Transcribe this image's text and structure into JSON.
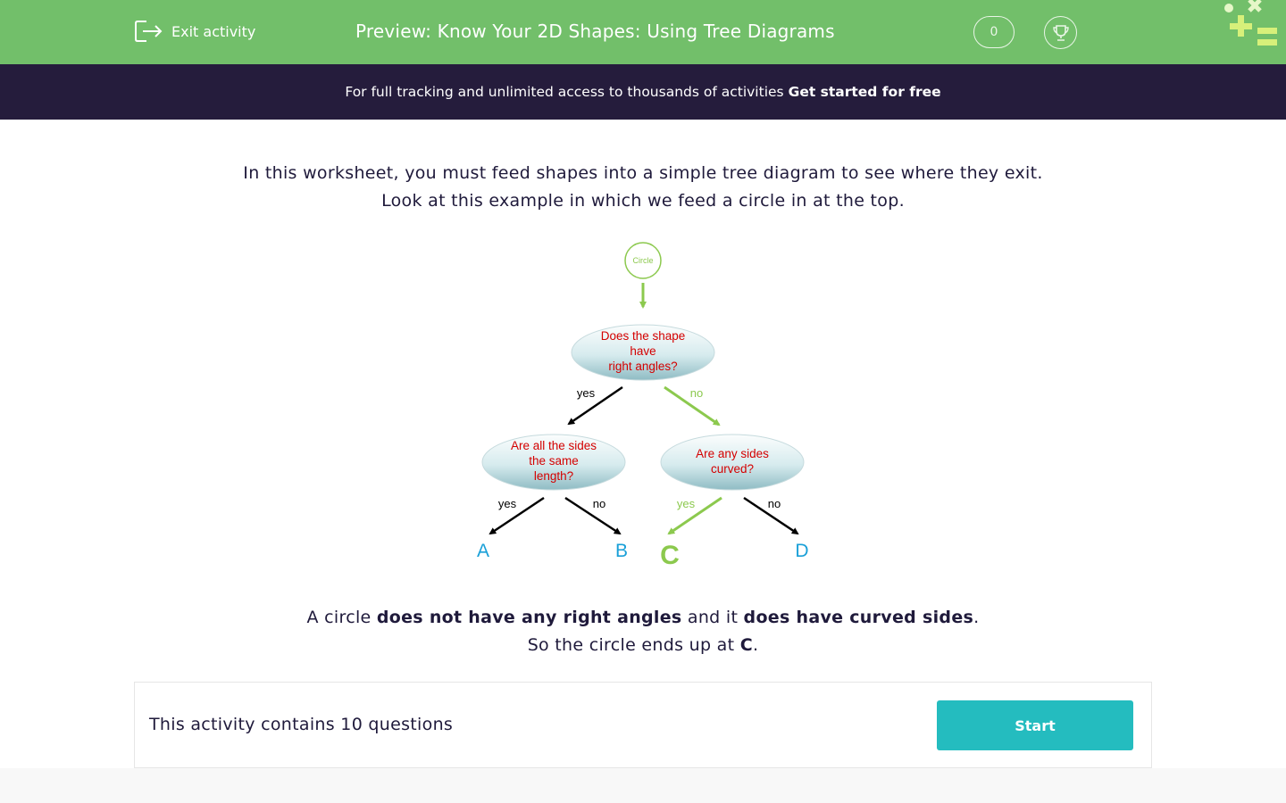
{
  "header": {
    "exit_label": "Exit activity",
    "title": "Preview: Know Your 2D Shapes: Using Tree Diagrams",
    "score": "0"
  },
  "banner": {
    "text": "For full tracking and unlimited access to thousands of activities",
    "cta": "Get started for free"
  },
  "intro": {
    "line1": "In this worksheet, you must feed shapes into a simple tree diagram to see where they exit.",
    "line2": "Look at this example in which we feed a circle in at the top."
  },
  "diagram": {
    "input_shape": "Circle",
    "q1": [
      "Does the shape",
      "have",
      "right angles?"
    ],
    "q2": [
      "Are all the sides",
      "the same",
      "length?"
    ],
    "q3": [
      "Are any sides",
      "curved?"
    ],
    "yes": "yes",
    "no": "no",
    "exits": [
      "A",
      "B",
      "C",
      "D"
    ],
    "highlight_color": "#8cc94e",
    "question_text_color": "#d40000",
    "exit_color": "#1aa0d8"
  },
  "explanation": {
    "l1_a": "A circle ",
    "l1_b": "does not have any right angles",
    "l1_c": " and it ",
    "l1_d": "does have curved sides",
    "l1_e": ".",
    "l2_a": "So the circle ends up at ",
    "l2_b": "C",
    "l2_c": "."
  },
  "activity": {
    "count_text": "This activity contains 10 questions",
    "start_label": "Start"
  },
  "colors": {
    "header_green": "#72bf6a",
    "banner_navy": "#251c3c",
    "start_teal": "#24bcbf"
  }
}
